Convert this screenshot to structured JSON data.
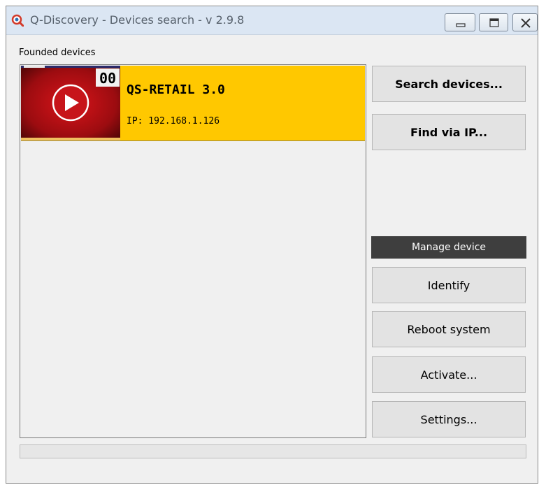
{
  "window": {
    "title": "Q-Discovery - Devices search - v 2.9.8",
    "app_icon": "q-search-icon",
    "controls": [
      "minimize-icon",
      "restore-icon",
      "close-icon"
    ]
  },
  "devices_group": {
    "label": "Founded devices",
    "items": [
      {
        "name": "QS-RETAIL 3.0",
        "ip": "IP: 192.168.1.126",
        "thumbnail_badge": "00",
        "thumbnail_icon": "play-icon",
        "selected": true
      }
    ]
  },
  "actions": {
    "search_label": "Search devices...",
    "find_ip_label": "Find via IP..."
  },
  "manage": {
    "header": "Manage device",
    "identify_label": "Identify",
    "reboot_label": "Reboot system",
    "activate_label": "Activate...",
    "settings_label": "Settings..."
  },
  "progress": {
    "value": 0
  },
  "colors": {
    "selected_item": "#ffc800",
    "section_header": "#3e3e3e",
    "titlebar": "#dbe6f3",
    "window_bg": "#f0f0f0"
  }
}
